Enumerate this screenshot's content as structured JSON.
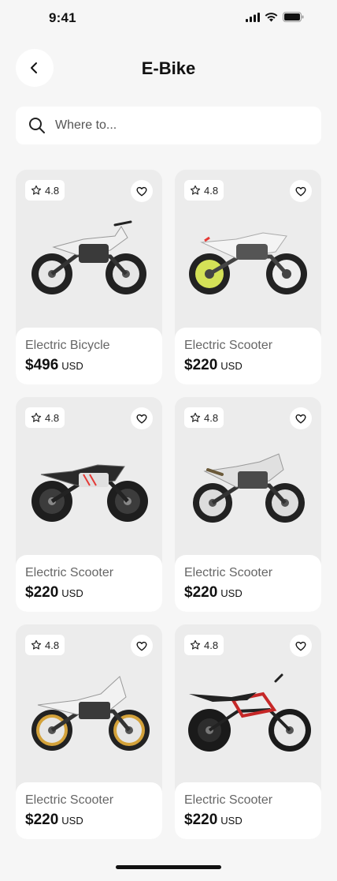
{
  "status": {
    "time": "9:41"
  },
  "header": {
    "title": "E-Bike"
  },
  "search": {
    "placeholder": "Where to..."
  },
  "products": [
    {
      "name": "Electric Bicycle",
      "price": "$496",
      "currency": "USD",
      "rating": "4.8",
      "accent": "#f0f0f0"
    },
    {
      "name": "Electric Scooter",
      "price": "$220",
      "currency": "USD",
      "rating": "4.8",
      "accent": "#d4e157"
    },
    {
      "name": "Electric Scooter",
      "price": "$220",
      "currency": "USD",
      "rating": "4.8",
      "accent": "#e53935"
    },
    {
      "name": "Electric Scooter",
      "price": "$220",
      "currency": "USD",
      "rating": "4.8",
      "accent": "#e0e0e0"
    },
    {
      "name": "Electric Scooter",
      "price": "$220",
      "currency": "USD",
      "rating": "4.8",
      "accent": "#d4a23a"
    },
    {
      "name": "Electric Scooter",
      "price": "$220",
      "currency": "USD",
      "rating": "4.8",
      "accent": "#c62828"
    }
  ],
  "icons": {
    "back": "chevron-left-icon",
    "search": "search-icon",
    "rating": "star-icon",
    "favorite": "heart-icon"
  }
}
